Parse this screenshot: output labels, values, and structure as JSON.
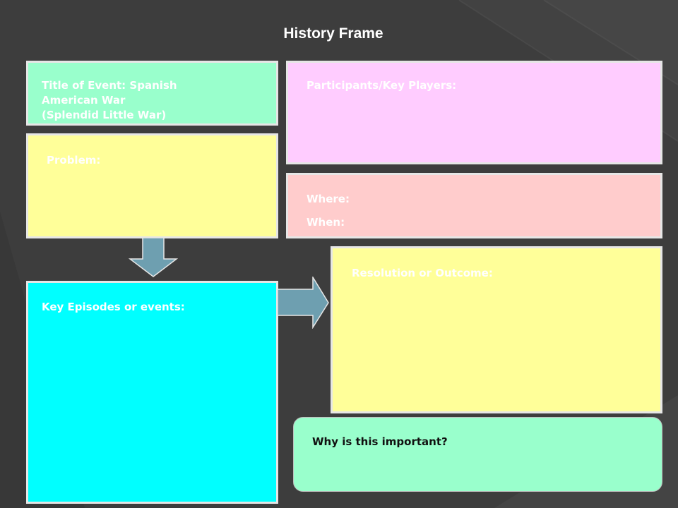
{
  "slide": {
    "title": "History Frame"
  },
  "boxes": {
    "title_of_event": {
      "lines": [
        "Title of Event: Spanish",
        "American War",
        "(Splendid Little War)"
      ]
    },
    "participants": {
      "label": "Participants/Key Players:"
    },
    "problem": {
      "label": "Problem:"
    },
    "where": {
      "label": "Where:"
    },
    "when": {
      "label": "When:"
    },
    "resolution": {
      "label": "Resolution or Outcome:"
    },
    "episodes": {
      "label": "Key Episodes or events:"
    },
    "important": {
      "label": "Why is this important?"
    }
  },
  "colors": {
    "background": "#3d3d3d",
    "mint": "#99ffcc",
    "pink": "#ffccff",
    "yellow": "#ffff99",
    "rose": "#ffcccc",
    "cyan": "#00ffff",
    "arrow": "#6e9fb0"
  }
}
